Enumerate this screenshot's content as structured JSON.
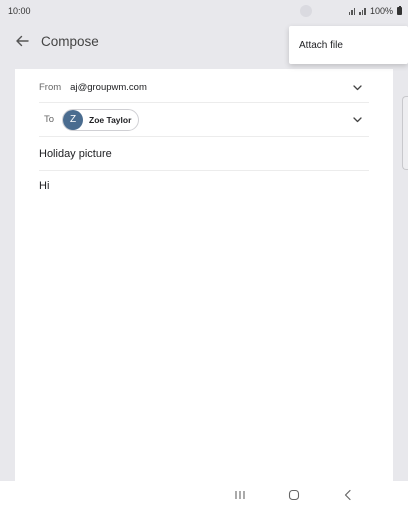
{
  "status_bar": {
    "time": "10:00",
    "battery_text": "100%",
    "icons": [
      "signal-icon",
      "signal-icon",
      "battery-icon"
    ]
  },
  "toolbar": {
    "title": "Compose",
    "back_icon": "arrow-back-icon"
  },
  "popup_menu": {
    "items": [
      {
        "label": "Attach file"
      }
    ]
  },
  "compose": {
    "from_label": "From",
    "from_value": "aj@groupwm.com",
    "to_label": "To",
    "recipient": {
      "initial": "Z",
      "name": "Zoe Taylor",
      "avatar_color": "#4a6c8f"
    },
    "subject": "Holiday picture",
    "body": "Hi"
  },
  "nav_bar": {
    "icons": [
      "recent-apps-icon",
      "home-icon",
      "back-icon"
    ]
  }
}
